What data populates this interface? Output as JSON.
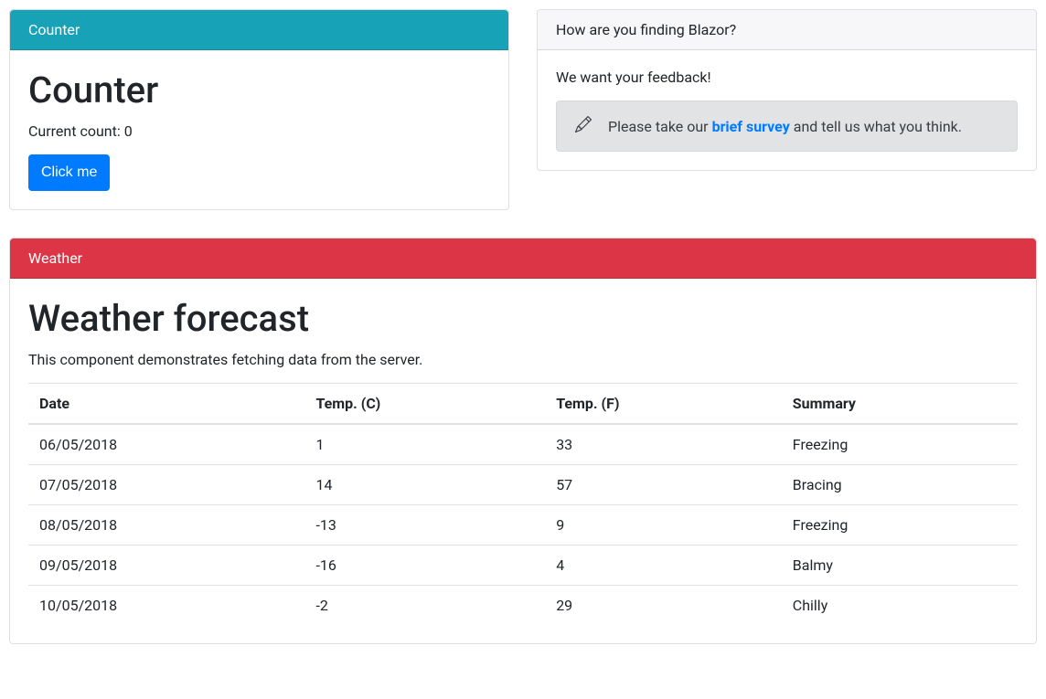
{
  "counter": {
    "header": "Counter",
    "title": "Counter",
    "count_label": "Current count: 0",
    "button_label": "Click me"
  },
  "survey": {
    "header": "How are you finding Blazor?",
    "feedback_text": "We want your feedback!",
    "prompt_before": "Please take our ",
    "link_text": "brief survey",
    "prompt_after": " and tell us what you think."
  },
  "weather": {
    "header": "Weather",
    "title": "Weather forecast",
    "subtitle": "This component demonstrates fetching data from the server.",
    "columns": [
      "Date",
      "Temp. (C)",
      "Temp. (F)",
      "Summary"
    ],
    "rows": [
      {
        "date": "06/05/2018",
        "c": "1",
        "f": "33",
        "summary": "Freezing"
      },
      {
        "date": "07/05/2018",
        "c": "14",
        "f": "57",
        "summary": "Bracing"
      },
      {
        "date": "08/05/2018",
        "c": "-13",
        "f": "9",
        "summary": "Freezing"
      },
      {
        "date": "09/05/2018",
        "c": "-16",
        "f": "4",
        "summary": "Balmy"
      },
      {
        "date": "10/05/2018",
        "c": "-2",
        "f": "29",
        "summary": "Chilly"
      }
    ]
  }
}
